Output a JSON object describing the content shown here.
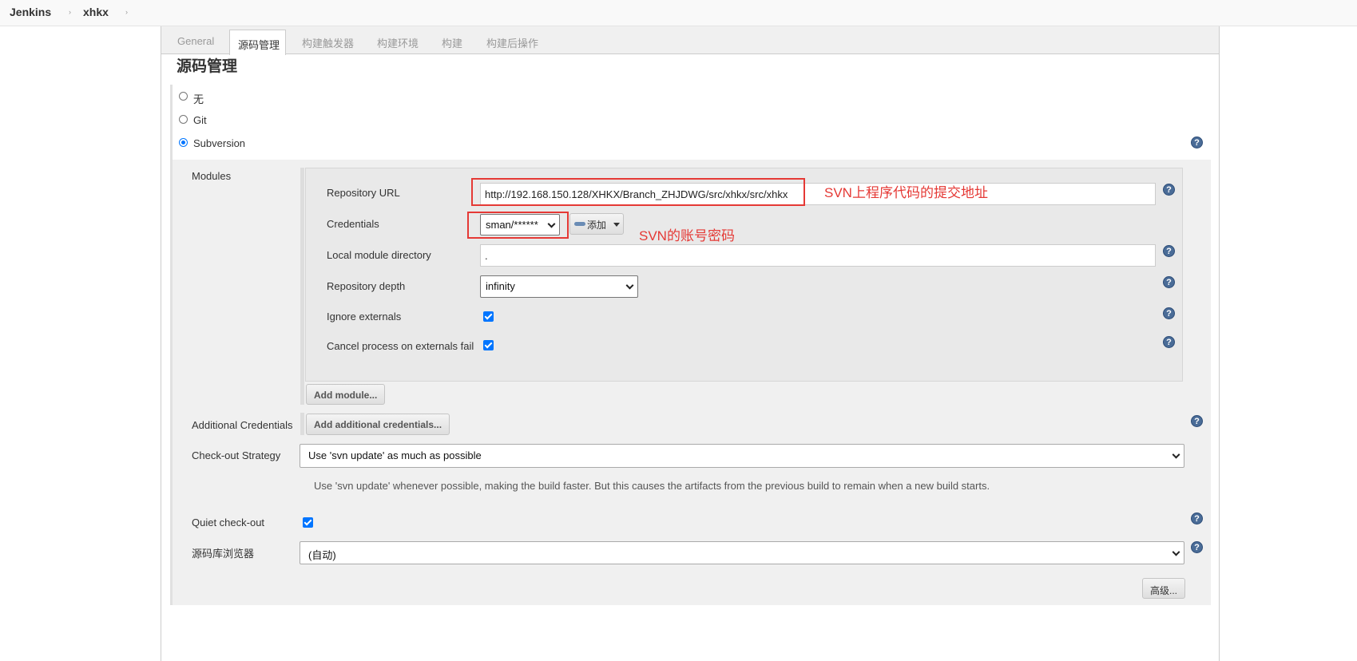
{
  "breadcrumb": {
    "root": "Jenkins",
    "job": "xhkx",
    "separator": "›"
  },
  "tabs": [
    "General",
    "源码管理",
    "构建触发器",
    "构建环境",
    "构建",
    "构建后操作"
  ],
  "section_title": "源码管理",
  "scm_options": [
    "无",
    "Git",
    "Subversion"
  ],
  "selected_scm": "Subversion",
  "modules": {
    "label": "Modules",
    "repository_url": {
      "label": "Repository URL",
      "value": "http://192.168.150.128/XHKX/Branch_ZHJDWG/src/xhkx/src/xhkx"
    },
    "credentials": {
      "label": "Credentials",
      "value": "sman/******",
      "add_label": "添加"
    },
    "local_module_directory": {
      "label": "Local module directory",
      "value": "."
    },
    "repository_depth": {
      "label": "Repository depth",
      "value": "infinity"
    },
    "ignore_externals": {
      "label": "Ignore externals",
      "checked": true
    },
    "cancel_process": {
      "label": "Cancel process on externals fail",
      "checked": true
    },
    "add_module_button": "Add module..."
  },
  "additional_credentials": {
    "label": "Additional Credentials",
    "button": "Add additional credentials..."
  },
  "checkout_strategy": {
    "label": "Check-out Strategy",
    "value": "Use 'svn update' as much as possible",
    "description": "Use 'svn update' whenever possible, making the build faster. But this causes the artifacts from the previous build to remain when a new build starts."
  },
  "quiet_checkout": {
    "label": "Quiet check-out",
    "checked": true
  },
  "repo_browser": {
    "label": "源码库浏览器",
    "value": "(自动)"
  },
  "advanced_button": "高级...",
  "help_glyph": "?",
  "annotations": {
    "url": "SVN上程序代码的提交地址",
    "credentials": "SVN的账号密码"
  },
  "colors": {
    "accent": "#0075ff",
    "annotation": "#e53935",
    "help": "#4a6c97"
  }
}
